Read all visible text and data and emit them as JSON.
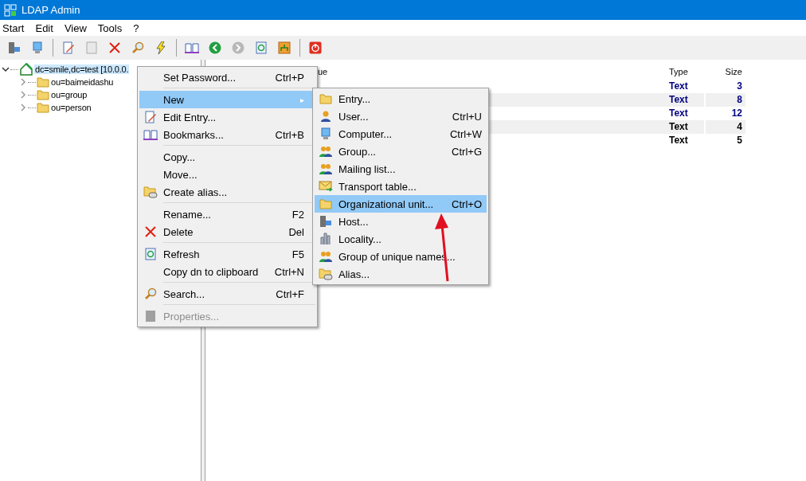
{
  "window": {
    "title": "LDAP Admin"
  },
  "menubar": [
    {
      "label": "Start"
    },
    {
      "label": "Edit"
    },
    {
      "label": "View"
    },
    {
      "label": "Tools"
    },
    {
      "label": "?"
    }
  ],
  "tree": [
    {
      "label": "dc=smile,dc=test [10.0.0.",
      "selected": true,
      "expanded": true,
      "children": [
        {
          "label": "ou=baimeidashu",
          "selected": false,
          "expanded": false
        },
        {
          "label": "ou=group",
          "selected": false,
          "expanded": false
        },
        {
          "label": "ou=person",
          "selected": false,
          "expanded": false
        }
      ]
    }
  ],
  "table": {
    "columns": [
      {
        "label": "ue"
      },
      {
        "label": "Type"
      },
      {
        "label": "Size"
      }
    ],
    "rows": [
      {
        "type": "Text",
        "size": "3",
        "color": "#000080"
      },
      {
        "type": "Text",
        "size": "8",
        "color": "#000080"
      },
      {
        "type": "Text",
        "size": "12",
        "color": "#000080"
      },
      {
        "type": "Text",
        "size": "4",
        "color": "#000000"
      },
      {
        "type": "Text",
        "size": "5",
        "color": "#000000"
      }
    ]
  },
  "context_menu": [
    {
      "kind": "item",
      "label": "Set Password...",
      "shortcut": "Ctrl+P",
      "selected": false,
      "disabled": false
    },
    {
      "kind": "separator"
    },
    {
      "kind": "submenu",
      "label": "New",
      "selected": true,
      "disabled": false,
      "arrow": "▸"
    },
    {
      "kind": "item",
      "label": "Edit Entry...",
      "selected": false,
      "disabled": false
    },
    {
      "kind": "item",
      "label": "Bookmarks...",
      "shortcut": "Ctrl+B",
      "selected": false,
      "disabled": false
    },
    {
      "kind": "separator"
    },
    {
      "kind": "item",
      "label": "Copy...",
      "selected": false,
      "disabled": false
    },
    {
      "kind": "item",
      "label": "Move...",
      "selected": false,
      "disabled": false
    },
    {
      "kind": "item",
      "label": "Create alias...",
      "selected": false,
      "disabled": false
    },
    {
      "kind": "separator"
    },
    {
      "kind": "item",
      "label": "Rename...",
      "shortcut": "F2",
      "selected": false,
      "disabled": false
    },
    {
      "kind": "item",
      "label": "Delete",
      "shortcut": "Del",
      "selected": false,
      "disabled": false
    },
    {
      "kind": "separator"
    },
    {
      "kind": "item",
      "label": "Refresh",
      "shortcut": "F5",
      "selected": false,
      "disabled": false
    },
    {
      "kind": "item",
      "label": "Copy dn to clipboard",
      "shortcut": "Ctrl+N",
      "selected": false,
      "disabled": false
    },
    {
      "kind": "separator"
    },
    {
      "kind": "item",
      "label": "Search...",
      "shortcut": "Ctrl+F",
      "selected": false,
      "disabled": false
    },
    {
      "kind": "separator"
    },
    {
      "kind": "item",
      "label": "Properties...",
      "selected": false,
      "disabled": true
    }
  ],
  "submenu": [
    {
      "label": "Entry...",
      "selected": false
    },
    {
      "label": "User...",
      "shortcut": "Ctrl+U",
      "selected": false
    },
    {
      "label": "Computer...",
      "shortcut": "Ctrl+W",
      "selected": false
    },
    {
      "label": "Group...",
      "shortcut": "Ctrl+G",
      "selected": false
    },
    {
      "label": "Mailing list...",
      "selected": false
    },
    {
      "label": "Transport table...",
      "selected": false
    },
    {
      "label": "Organizational unit...",
      "shortcut": "Ctrl+O",
      "selected": true
    },
    {
      "label": "Host...",
      "selected": false
    },
    {
      "label": "Locality...",
      "selected": false
    },
    {
      "label": "Group of unique names...",
      "selected": false
    },
    {
      "label": "Alias...",
      "selected": false
    }
  ]
}
